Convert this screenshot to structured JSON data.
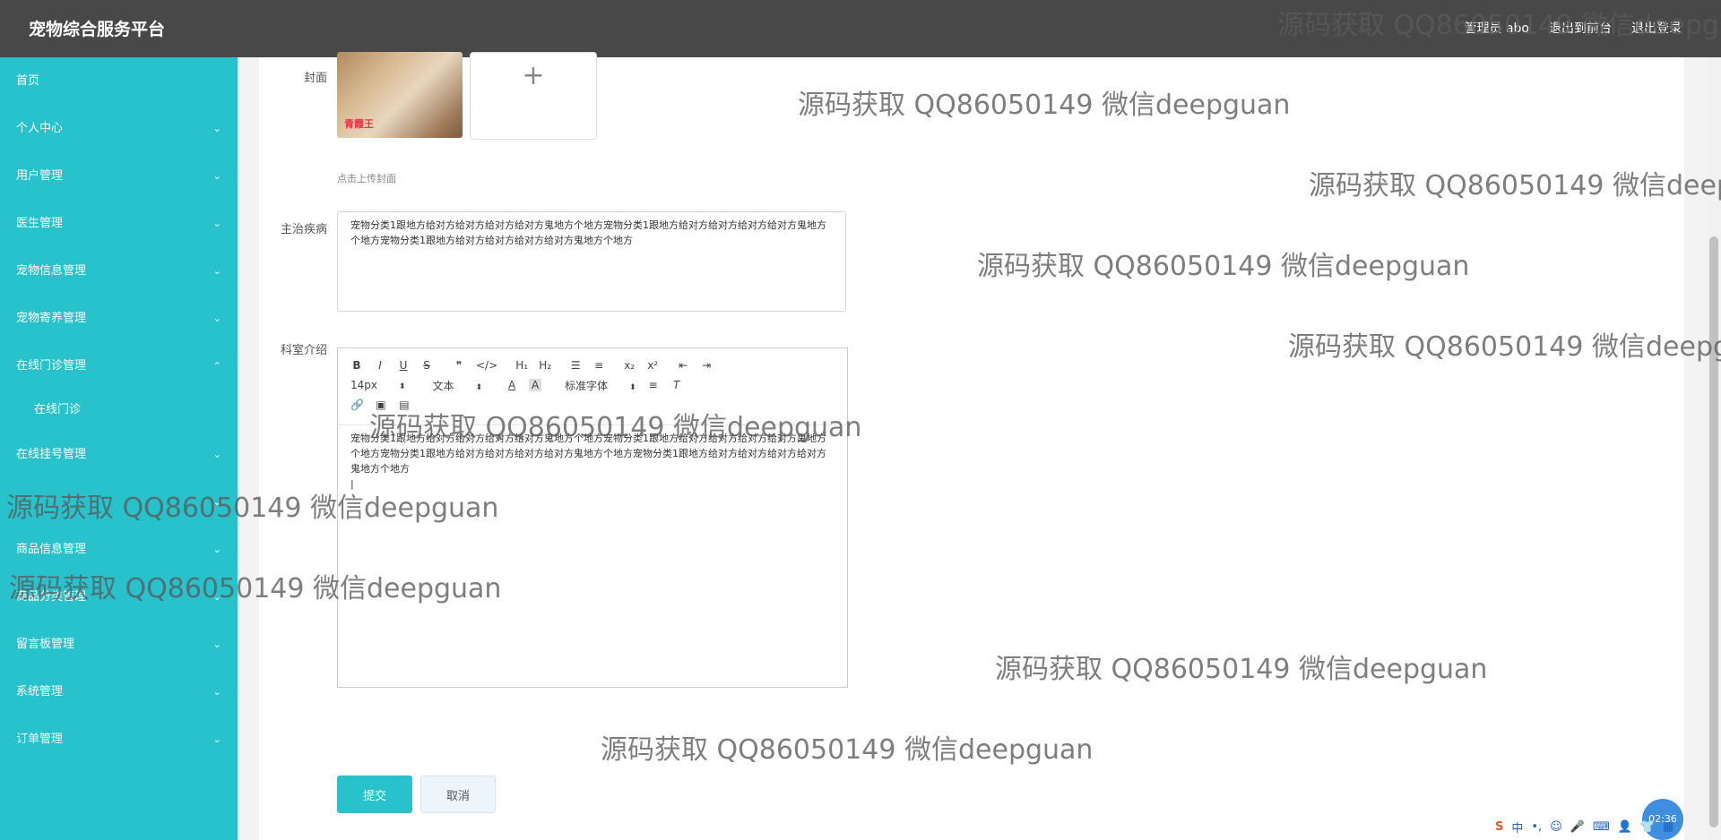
{
  "header": {
    "app_title": "宠物综合服务平台",
    "links": [
      "管理员 abo",
      "退出到前台",
      "退出登录"
    ]
  },
  "sidebar": {
    "home": "首页",
    "groups": [
      {
        "label": "个人中心",
        "expanded": false
      },
      {
        "label": "用户管理",
        "expanded": false
      },
      {
        "label": "医生管理",
        "expanded": false
      },
      {
        "label": "宠物信息管理",
        "expanded": false
      },
      {
        "label": "宠物寄养管理",
        "expanded": false
      },
      {
        "label": "在线门诊管理",
        "expanded": true,
        "sub": "在线门诊"
      },
      {
        "label": "在线挂号管理",
        "expanded": false
      },
      {
        "label": "",
        "expanded": false
      },
      {
        "label": "商品信息管理",
        "expanded": false
      },
      {
        "label": "商品分类管理",
        "expanded": false
      },
      {
        "label": "留言板管理",
        "expanded": false
      },
      {
        "label": "系统管理",
        "expanded": false
      },
      {
        "label": "订单管理",
        "expanded": false
      }
    ]
  },
  "form": {
    "cover_label": "封面",
    "cover_caption": "青霞王",
    "upload_hint": "点击上传封面",
    "disease_label": "主治疾病",
    "disease_value": "宠物分类1跟地方给对方给对方给对方给对方鬼地方个地方宠物分类1跟地方给对方给对方给对方给对方鬼地方个地方宠物分类1跟地方给对方给对方给对方给对方鬼地方个地方",
    "intro_label": "科室介绍",
    "editor": {
      "font_size": "14px",
      "block_type": "文本",
      "font_family": "标准字体",
      "content": "宠物分类1跟地方给对方给对方给对方给对方鬼地方个地方宠物分类1跟地方给对方给对方给对方给对方鬼地方个地方宠物分类1跟地方给对方给对方给对方给对方鬼地方个地方宠物分类1跟地方给对方给对方给对方给对方鬼地方个地方"
    },
    "submit": "提交",
    "cancel": "取消"
  },
  "watermark": "源码获取 QQ86050149 微信deepguan",
  "clock": "02:36",
  "ime": [
    "S",
    "中",
    "•,",
    "☺",
    "🎤",
    "⌨",
    "👤",
    "👕",
    "▦"
  ]
}
